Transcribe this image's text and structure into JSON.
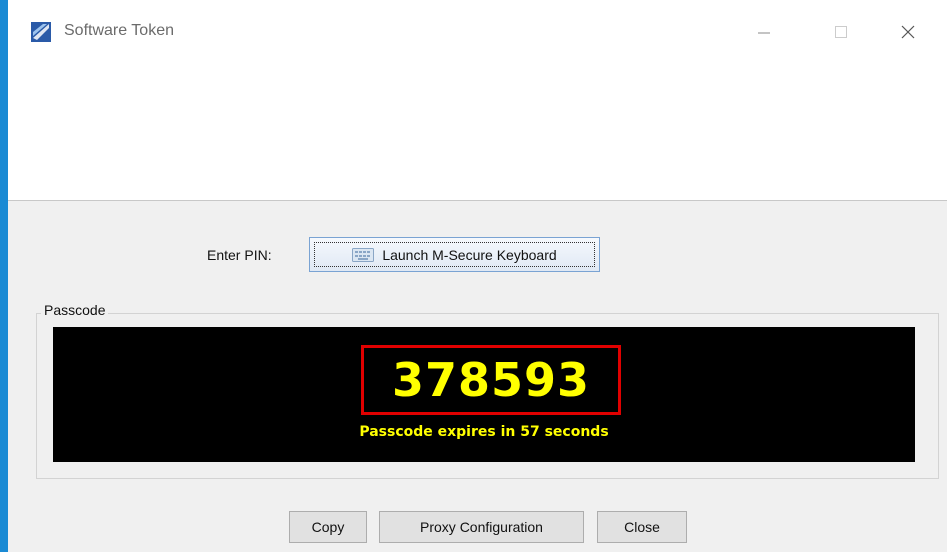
{
  "window": {
    "title": "Software Token",
    "controls": {
      "minimize": "minimize-icon",
      "maximize": "maximize-icon",
      "close": "close-icon"
    }
  },
  "pin": {
    "label": "Enter PIN:",
    "launch_button_label": "Launch M-Secure Keyboard",
    "launch_button_icon": "keyboard-icon"
  },
  "passcode": {
    "group_label": "Passcode",
    "code": "378593",
    "expiry_text": "Passcode expires in 57 seconds"
  },
  "buttons": {
    "copy": "Copy",
    "proxy": "Proxy Configuration",
    "close": "Close"
  },
  "colors": {
    "accent": "#1a8ad4",
    "display_bg": "#000000",
    "code_text": "#ffff00",
    "highlight_box": "#e00000"
  }
}
